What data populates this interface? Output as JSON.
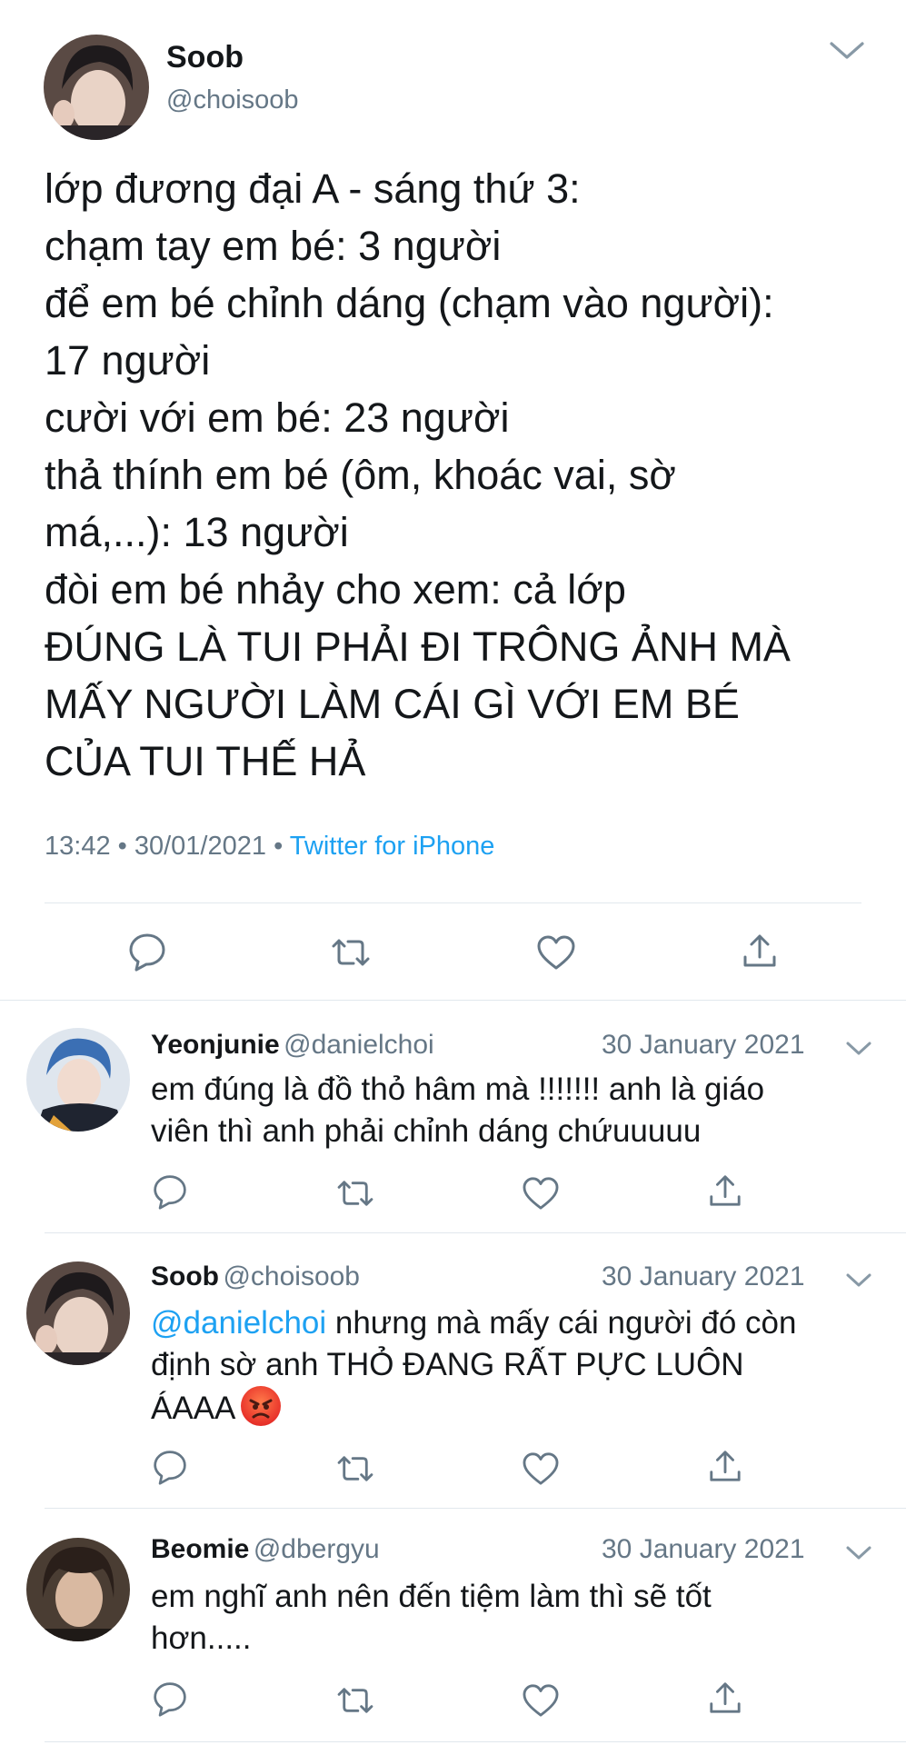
{
  "main_tweet": {
    "author": {
      "name": "Soob",
      "handle": "@choisoob",
      "avatar": "avatar-soob"
    },
    "lines": [
      "lớp đương đại A - sáng thứ 3:",
      "chạm tay em bé: 3 người",
      "để em bé chỉnh dáng (chạm vào người):",
      "17 người",
      "cười với em bé: 23 người",
      "thả thính em bé (ôm, khoác vai, sờ",
      "má,...): 13 người",
      "đòi em bé nhảy cho xem: cả lớp",
      "ĐÚNG LÀ TUI PHẢI ĐI TRÔNG ẢNH MÀ",
      "MẤY NGƯỜI LÀM CÁI GÌ VỚI EM BÉ",
      "CỦA TUI THẾ HẢ"
    ],
    "time": "13:42",
    "separator": "•",
    "date": "30/01/2021",
    "source": "Twitter for iPhone"
  },
  "icons": {
    "more": "chevron-down-icon",
    "reply": "reply-icon",
    "retweet": "retweet-icon",
    "like": "heart-icon",
    "share": "share-icon"
  },
  "colors": {
    "link": "#1da1f2",
    "secondary_text": "#657786",
    "divider": "#e1e8ed"
  },
  "replies": [
    {
      "name": "Yeonjunie",
      "handle": "@danielchoi",
      "date": "30 January 2021",
      "lines": [
        "em đúng là đồ thỏ hâm mà !!!!!!! anh là giáo",
        "viên thì anh phải chỉnh dáng chứuuuuu"
      ]
    },
    {
      "name": "Soob",
      "handle": "@choisoob",
      "date": "30 January 2021",
      "mention": "@danielchoi",
      "lines": [
        " nhưng mà mấy cái người đó còn",
        "định sờ anh THỎ ĐANG RẤT PỰC LUÔN",
        "ÁAAA"
      ],
      "emoji": "angry-face-emoji"
    },
    {
      "name": "Beomie",
      "handle": "@dbergyu",
      "date": "30 January 2021",
      "lines": [
        "em nghĩ anh nên đến tiệm làm thì sẽ tốt",
        "hơn....."
      ]
    }
  ]
}
